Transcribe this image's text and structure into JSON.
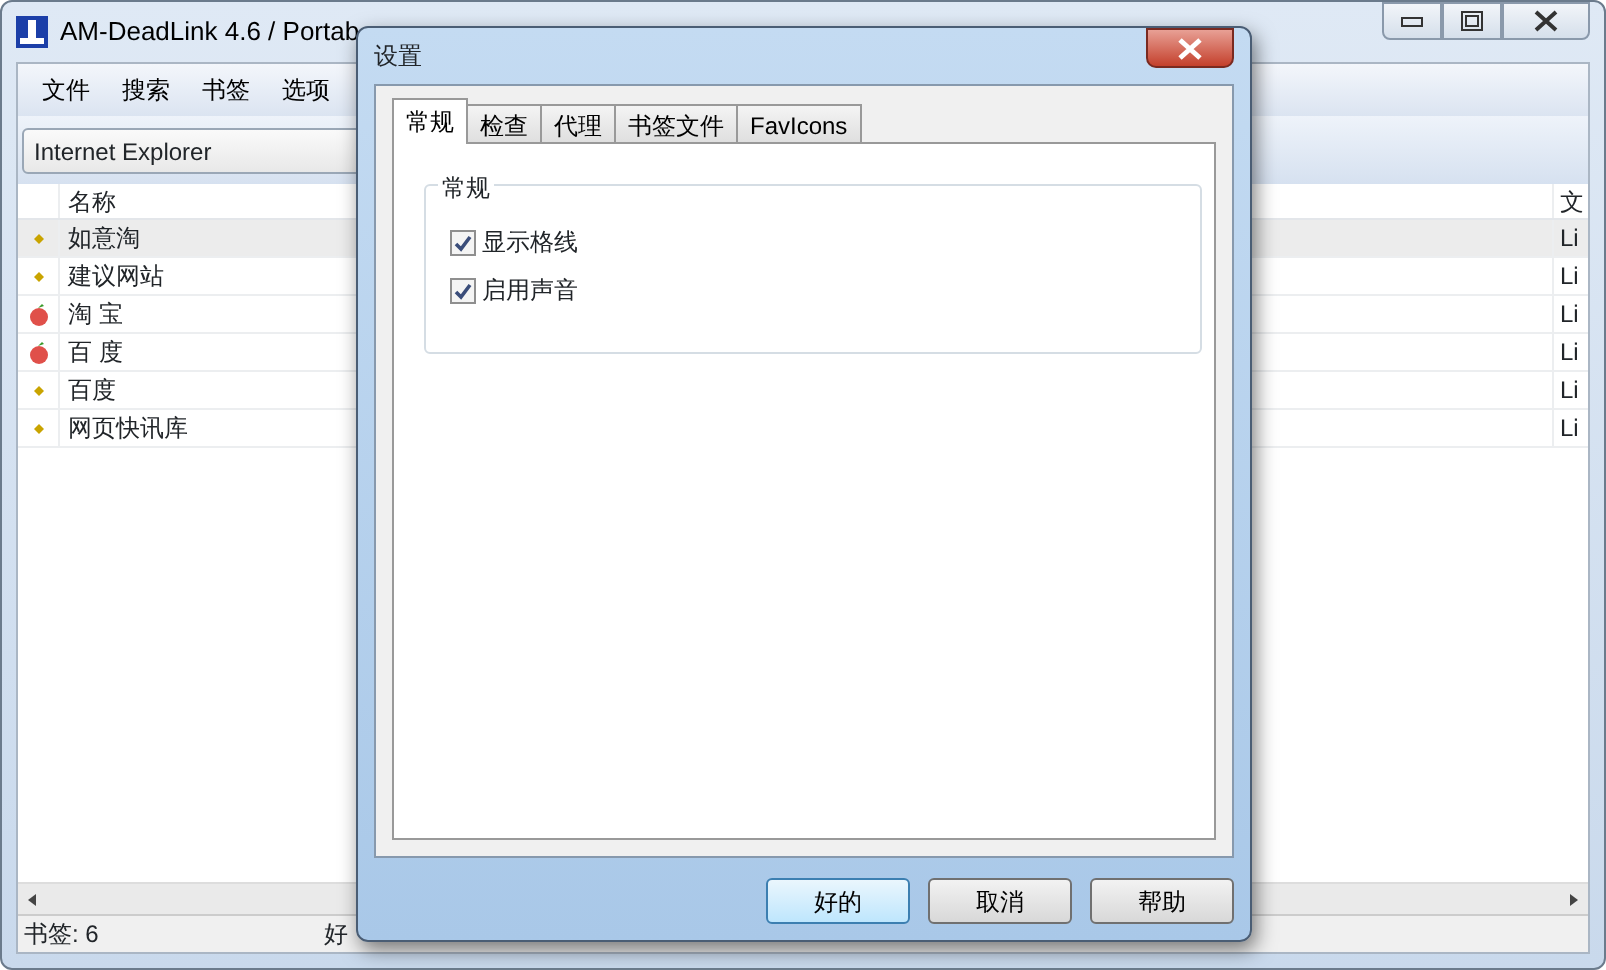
{
  "window": {
    "title": "AM-DeadLink 4.6 / Portab"
  },
  "menu": [
    "文件",
    "搜索",
    "书签",
    "选项"
  ],
  "browser_select": {
    "value": "Internet Explorer"
  },
  "table": {
    "columns": [
      "名称",
      "文"
    ],
    "rows": [
      {
        "kind": "dot",
        "name": "如意淘",
        "column_2": "Li",
        "selected": true
      },
      {
        "kind": "dot",
        "name": "建议网站",
        "column_2": "Li",
        "selected": false
      },
      {
        "kind": "fruit",
        "name": "淘 宝",
        "column_2": "Li",
        "selected": false
      },
      {
        "kind": "fruit",
        "name": "百 度",
        "column_2": "Li",
        "selected": false
      },
      {
        "kind": "dot",
        "name": "百度",
        "column_2": "Li",
        "selected": false
      },
      {
        "kind": "dot",
        "name": "网页快讯库",
        "column_2": "Li",
        "selected": false
      }
    ]
  },
  "status_bar": [
    "书签: 6",
    "好"
  ],
  "dialog": {
    "title": "设置",
    "tabs": [
      {
        "label": "常规",
        "selected": true
      },
      {
        "label": "检查",
        "selected": false
      },
      {
        "label": "代理",
        "selected": false
      },
      {
        "label": "书签文件",
        "selected": false
      },
      {
        "label": "FavIcons",
        "selected": false
      }
    ],
    "group": {
      "title": "常规",
      "options": [
        {
          "label": "显示格线",
          "checked": true
        },
        {
          "label": "启用声音",
          "checked": true
        }
      ]
    },
    "buttons": [
      {
        "label": "好的",
        "default": true
      },
      {
        "label": "取消",
        "default": false
      },
      {
        "label": "帮助",
        "default": false
      }
    ]
  }
}
